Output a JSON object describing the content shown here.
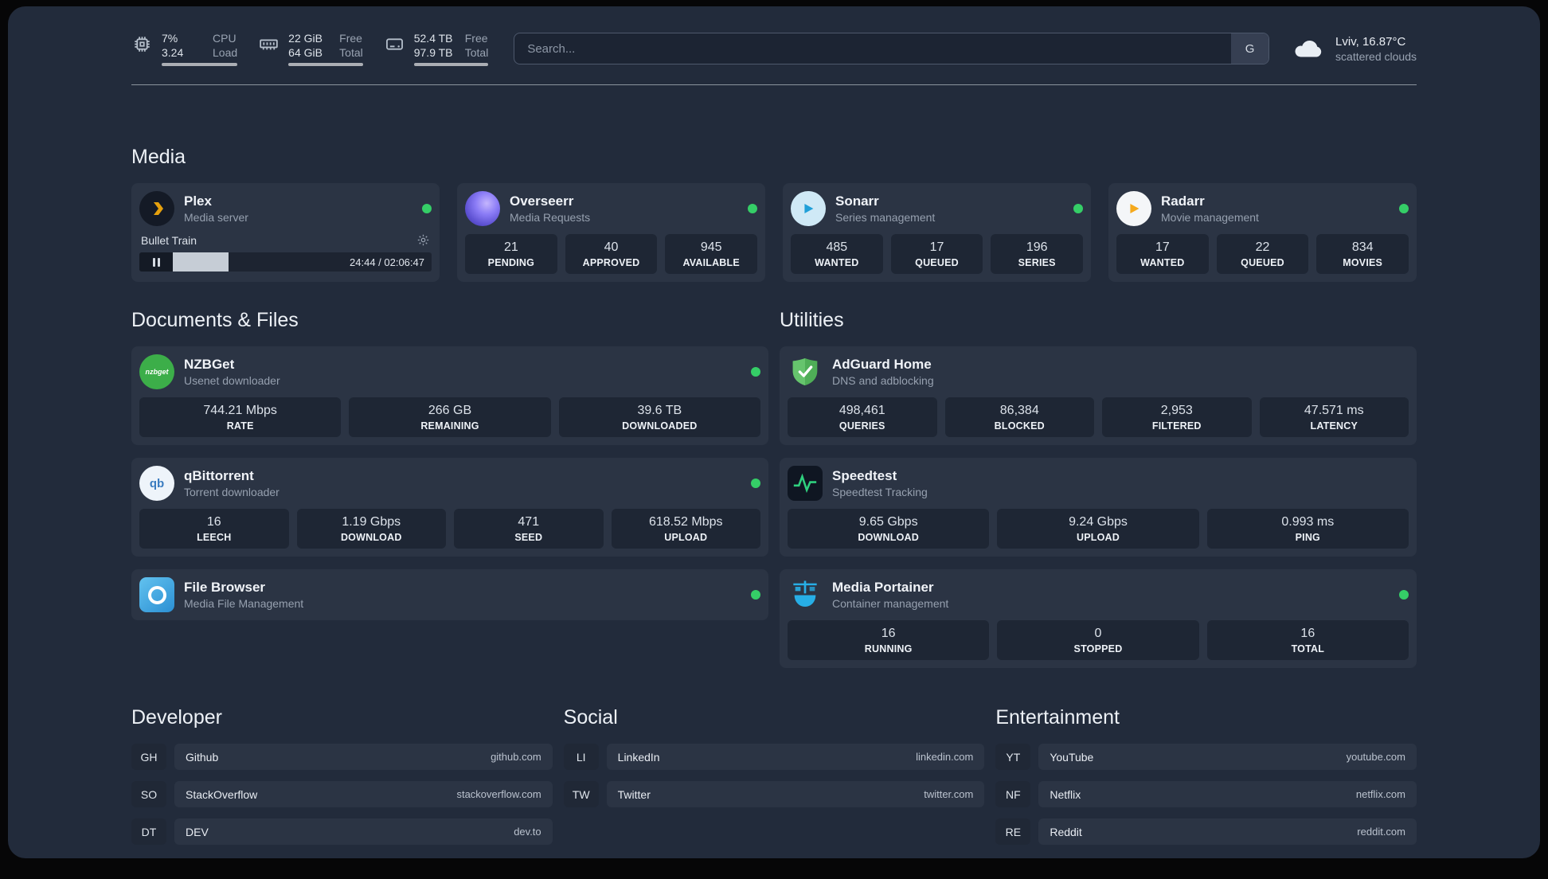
{
  "theme": {
    "background": "#222b3b",
    "card": "#2b3444",
    "stat_box": "#1e2634",
    "status_dot": "#35ce67",
    "plex_gold": "#e5a00d"
  },
  "topbar": {
    "cpu": {
      "value_top": "7%",
      "label_top": "CPU",
      "value_bottom": "3.24",
      "label_bottom": "Load"
    },
    "ram": {
      "value_top": "22 GiB",
      "label_top": "Free",
      "value_bottom": "64 GiB",
      "label_bottom": "Total"
    },
    "disk": {
      "value_top": "52.4 TB",
      "label_top": "Free",
      "value_bottom": "97.9 TB",
      "label_bottom": "Total"
    },
    "search": {
      "placeholder": "Search...",
      "button": "G"
    },
    "weather": {
      "location": "Lviv, 16.87°C",
      "condition": "scattered clouds"
    }
  },
  "sections": {
    "media": {
      "title": "Media"
    },
    "documents": {
      "title": "Documents & Files"
    },
    "utilities": {
      "title": "Utilities"
    }
  },
  "apps": {
    "plex": {
      "name": "Plex",
      "desc": "Media server",
      "player": {
        "title": "Bullet Train",
        "time": "24:44 / 02:06:47"
      }
    },
    "overseerr": {
      "name": "Overseerr",
      "desc": "Media Requests",
      "stats": [
        {
          "value": "21",
          "label": "PENDING"
        },
        {
          "value": "40",
          "label": "APPROVED"
        },
        {
          "value": "945",
          "label": "AVAILABLE"
        }
      ]
    },
    "sonarr": {
      "name": "Sonarr",
      "desc": "Series management",
      "stats": [
        {
          "value": "485",
          "label": "WANTED"
        },
        {
          "value": "17",
          "label": "QUEUED"
        },
        {
          "value": "196",
          "label": "SERIES"
        }
      ]
    },
    "radarr": {
      "name": "Radarr",
      "desc": "Movie management",
      "stats": [
        {
          "value": "17",
          "label": "WANTED"
        },
        {
          "value": "22",
          "label": "QUEUED"
        },
        {
          "value": "834",
          "label": "MOVIES"
        }
      ]
    },
    "nzbget": {
      "name": "NZBGet",
      "desc": "Usenet downloader",
      "icon_text": "nzbget",
      "stats": [
        {
          "value": "744.21 Mbps",
          "label": "RATE"
        },
        {
          "value": "266 GB",
          "label": "REMAINING"
        },
        {
          "value": "39.6 TB",
          "label": "DOWNLOADED"
        }
      ]
    },
    "qbittorrent": {
      "name": "qBittorrent",
      "desc": "Torrent downloader",
      "icon_text": "qb",
      "stats": [
        {
          "value": "16",
          "label": "LEECH"
        },
        {
          "value": "1.19 Gbps",
          "label": "DOWNLOAD"
        },
        {
          "value": "471",
          "label": "SEED"
        },
        {
          "value": "618.52 Mbps",
          "label": "UPLOAD"
        }
      ]
    },
    "filebrowser": {
      "name": "File Browser",
      "desc": "Media File Management"
    },
    "adguard": {
      "name": "AdGuard Home",
      "desc": "DNS and adblocking",
      "stats": [
        {
          "value": "498,461",
          "label": "QUERIES"
        },
        {
          "value": "86,384",
          "label": "BLOCKED"
        },
        {
          "value": "2,953",
          "label": "FILTERED"
        },
        {
          "value": "47.571 ms",
          "label": "LATENCY"
        }
      ]
    },
    "speedtest": {
      "name": "Speedtest",
      "desc": "Speedtest Tracking",
      "stats": [
        {
          "value": "9.65 Gbps",
          "label": "DOWNLOAD"
        },
        {
          "value": "9.24 Gbps",
          "label": "UPLOAD"
        },
        {
          "value": "0.993 ms",
          "label": "PING"
        }
      ]
    },
    "portainer": {
      "name": "Media Portainer",
      "desc": "Container management",
      "stats": [
        {
          "value": "16",
          "label": "RUNNING"
        },
        {
          "value": "0",
          "label": "STOPPED"
        },
        {
          "value": "16",
          "label": "TOTAL"
        }
      ]
    }
  },
  "bookmarks": {
    "developer": {
      "title": "Developer",
      "items": [
        {
          "abbr": "GH",
          "name": "Github",
          "url": "github.com"
        },
        {
          "abbr": "SO",
          "name": "StackOverflow",
          "url": "stackoverflow.com"
        },
        {
          "abbr": "DT",
          "name": "DEV",
          "url": "dev.to"
        }
      ]
    },
    "social": {
      "title": "Social",
      "items": [
        {
          "abbr": "LI",
          "name": "LinkedIn",
          "url": "linkedin.com"
        },
        {
          "abbr": "TW",
          "name": "Twitter",
          "url": "twitter.com"
        }
      ]
    },
    "entertainment": {
      "title": "Entertainment",
      "items": [
        {
          "abbr": "YT",
          "name": "YouTube",
          "url": "youtube.com"
        },
        {
          "abbr": "NF",
          "name": "Netflix",
          "url": "netflix.com"
        },
        {
          "abbr": "RE",
          "name": "Reddit",
          "url": "reddit.com"
        }
      ]
    }
  }
}
